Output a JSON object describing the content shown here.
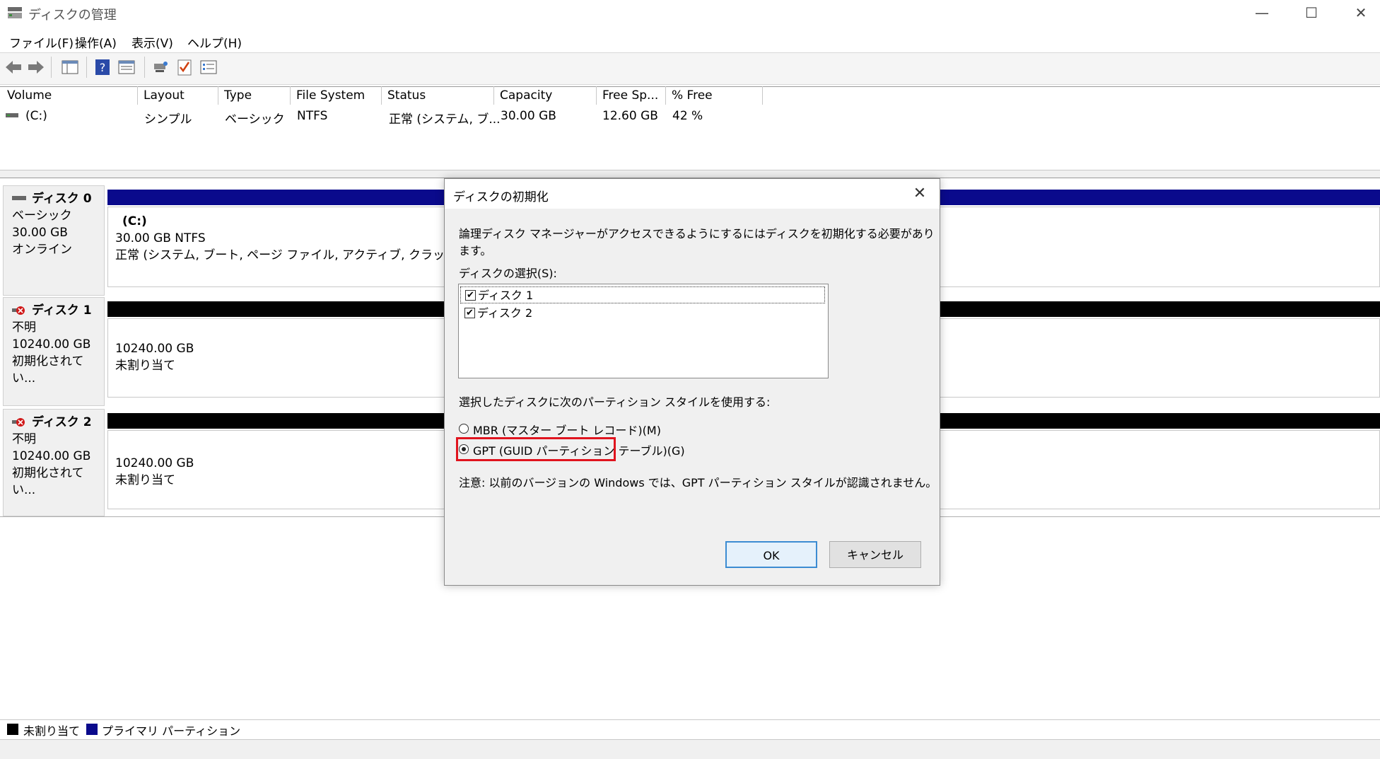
{
  "window": {
    "title": "ディスクの管理",
    "controls": {
      "minimize": "—",
      "maximize": "☐",
      "close": "✕"
    }
  },
  "menu": [
    "ファイル(F)",
    "操作(A)",
    "表示(V)",
    "ヘルプ(H)"
  ],
  "toolbar": [
    "back-arrow-icon",
    "forward-arrow-icon",
    "console-tree-icon",
    "help-icon",
    "properties-icon",
    "connect-icon",
    "checklist-icon",
    "list-icon"
  ],
  "volume_list": {
    "columns": [
      "Volume",
      "Layout",
      "Type",
      "File System",
      "Status",
      "Capacity",
      "Free Sp...",
      "% Free"
    ],
    "rows": [
      [
        "(C:)",
        "シンプル",
        "ベーシック",
        "NTFS",
        "正常 (システム, ブ...",
        "30.00 GB",
        "12.60 GB",
        "42 %"
      ]
    ]
  },
  "disks": [
    {
      "name": "ディスク 0",
      "type": "ベーシック",
      "size": "30.00 GB",
      "state": "オンライン",
      "bar_color": "#0a0a8c",
      "partition": {
        "title": "(C:)",
        "line1": "30.00 GB NTFS",
        "line2": "正常 (システム, ブート, ページ ファイル, アクティブ, クラッシュ ダンプ, プラ"
      }
    },
    {
      "name": "ディスク 1",
      "type": "不明",
      "size": "10240.00 GB",
      "state": "初期化されてい...",
      "bar_color": "#000000",
      "partition": {
        "title": "",
        "line1": "10240.00 GB",
        "line2": "未割り当て"
      }
    },
    {
      "name": "ディスク 2",
      "type": "不明",
      "size": "10240.00 GB",
      "state": "初期化されてい...",
      "bar_color": "#000000",
      "partition": {
        "title": "",
        "line1": "10240.00 GB",
        "line2": "未割り当て"
      }
    }
  ],
  "legend": [
    {
      "label": "未割り当て",
      "color": "#000000"
    },
    {
      "label": "プライマリ パーティション",
      "color": "#0a0a8c"
    }
  ],
  "dialog": {
    "title": "ディスクの初期化",
    "close": "✕",
    "message": "論理ディスク マネージャーがアクセスできるようにするにはディスクを初期化する必要があります。",
    "select_label": "ディスクの選択(S):",
    "disks": [
      {
        "label": "ディスク 1",
        "checked": true
      },
      {
        "label": "ディスク 2",
        "checked": true
      }
    ],
    "check_mark": "✔",
    "style_label": "選択したディスクに次のパーティション スタイルを使用する:",
    "options": [
      {
        "label": "MBR (マスター ブート レコード)(M)",
        "selected": false
      },
      {
        "label": "GPT (GUID パーティション テーブル)(G)",
        "selected": true
      }
    ],
    "note": "注意: 以前のバージョンの Windows では、GPT パーティション スタイルが認識されません。",
    "ok": "OK",
    "cancel": "キャンセル",
    "highlight_color": "#e0141e"
  }
}
